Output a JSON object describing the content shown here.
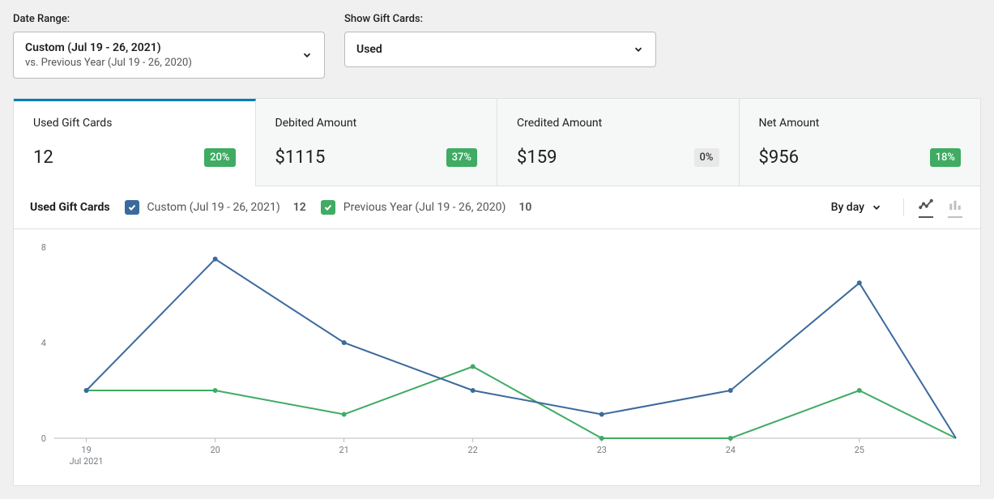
{
  "filters": {
    "date_range_label": "Date Range:",
    "show_label": "Show Gift Cards:",
    "date_main": "Custom (Jul 19 - 26, 2021)",
    "date_sub": "vs. Previous Year (Jul 19 - 26, 2020)",
    "show_value": "Used"
  },
  "cards": [
    {
      "title": "Used Gift Cards",
      "value": "12",
      "delta": "20%",
      "delta_style": "green"
    },
    {
      "title": "Debited Amount",
      "value": "$1115",
      "delta": "37%",
      "delta_style": "green"
    },
    {
      "title": "Credited Amount",
      "value": "$159",
      "delta": "0%",
      "delta_style": "gray"
    },
    {
      "title": "Net Amount",
      "value": "$956",
      "delta": "18%",
      "delta_style": "green"
    }
  ],
  "chart": {
    "title": "Used Gift Cards",
    "legend_a": "Custom (Jul 19 - 26, 2021)",
    "legend_a_val": "12",
    "legend_b": "Previous Year (Jul 19 - 26, 2020)",
    "legend_b_val": "10",
    "granularity": "By day"
  },
  "chart_data": {
    "type": "line",
    "title": "Used Gift Cards",
    "xlabel": "Jul 2021",
    "ylabel": "",
    "ylim": [
      0,
      8
    ],
    "categories": [
      "19",
      "20",
      "21",
      "22",
      "23",
      "24",
      "25"
    ],
    "sub_xlabel": "Jul 2021",
    "series": [
      {
        "name": "Custom (Jul 19 - 26, 2021)",
        "values": [
          2,
          7.5,
          4,
          2,
          1,
          2,
          6.5
        ],
        "tail": 0
      },
      {
        "name": "Previous Year (Jul 19 - 26, 2020)",
        "values": [
          2,
          2,
          1,
          3,
          0,
          0,
          2
        ],
        "tail": 0
      }
    ],
    "y_ticks": [
      0,
      4,
      8
    ]
  }
}
